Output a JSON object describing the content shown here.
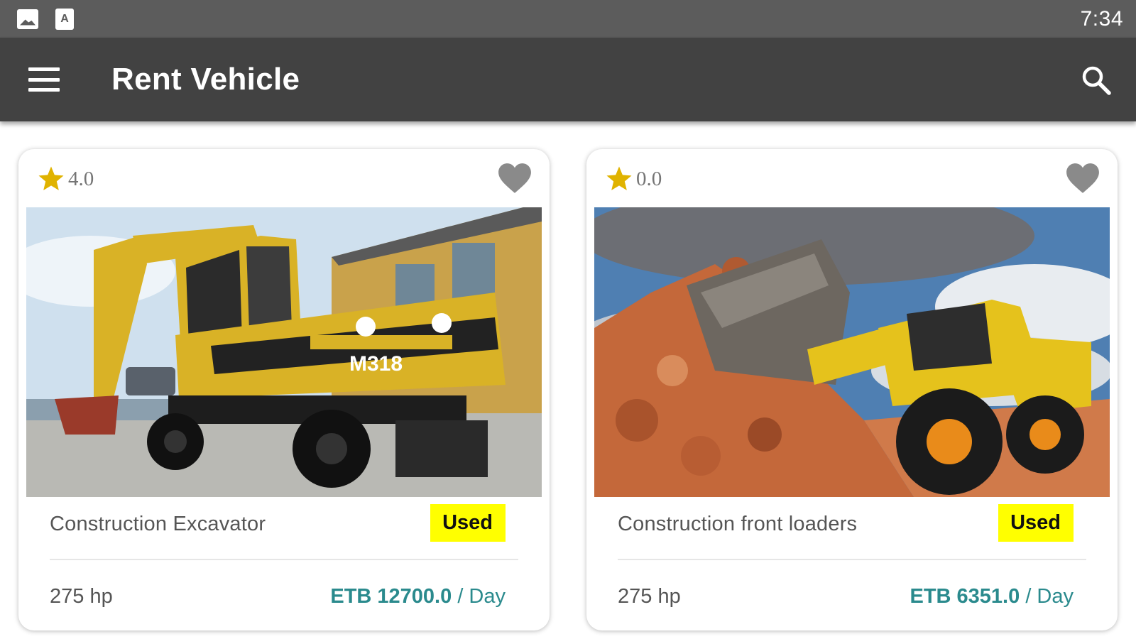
{
  "status_bar": {
    "time": "7:34",
    "icons": [
      "image-notification-icon",
      "text-notification-icon"
    ]
  },
  "app_bar": {
    "title": "Rent Vehicle",
    "menu_icon": "hamburger-menu-icon",
    "search_icon": "search-icon"
  },
  "colors": {
    "status_bar": "#5c5c5c",
    "app_bar": "#424242",
    "star": "#e0b300",
    "badge": "#ffff00",
    "price": "#2a8a8d",
    "heart": "#8a8a8a"
  },
  "vehicles": [
    {
      "rating": "4.0",
      "name": "Construction Excavator",
      "condition": "Used",
      "power": "275 hp",
      "price": "ETB 12700.0",
      "price_unit": "/ Day",
      "image_text": "M318",
      "image_icon": "excavator-photo"
    },
    {
      "rating": "0.0",
      "name": "Construction front loaders",
      "condition": "Used",
      "power": "275 hp",
      "price": "ETB 6351.0",
      "price_unit": "/ Day",
      "image_icon": "front-loader-photo"
    }
  ]
}
